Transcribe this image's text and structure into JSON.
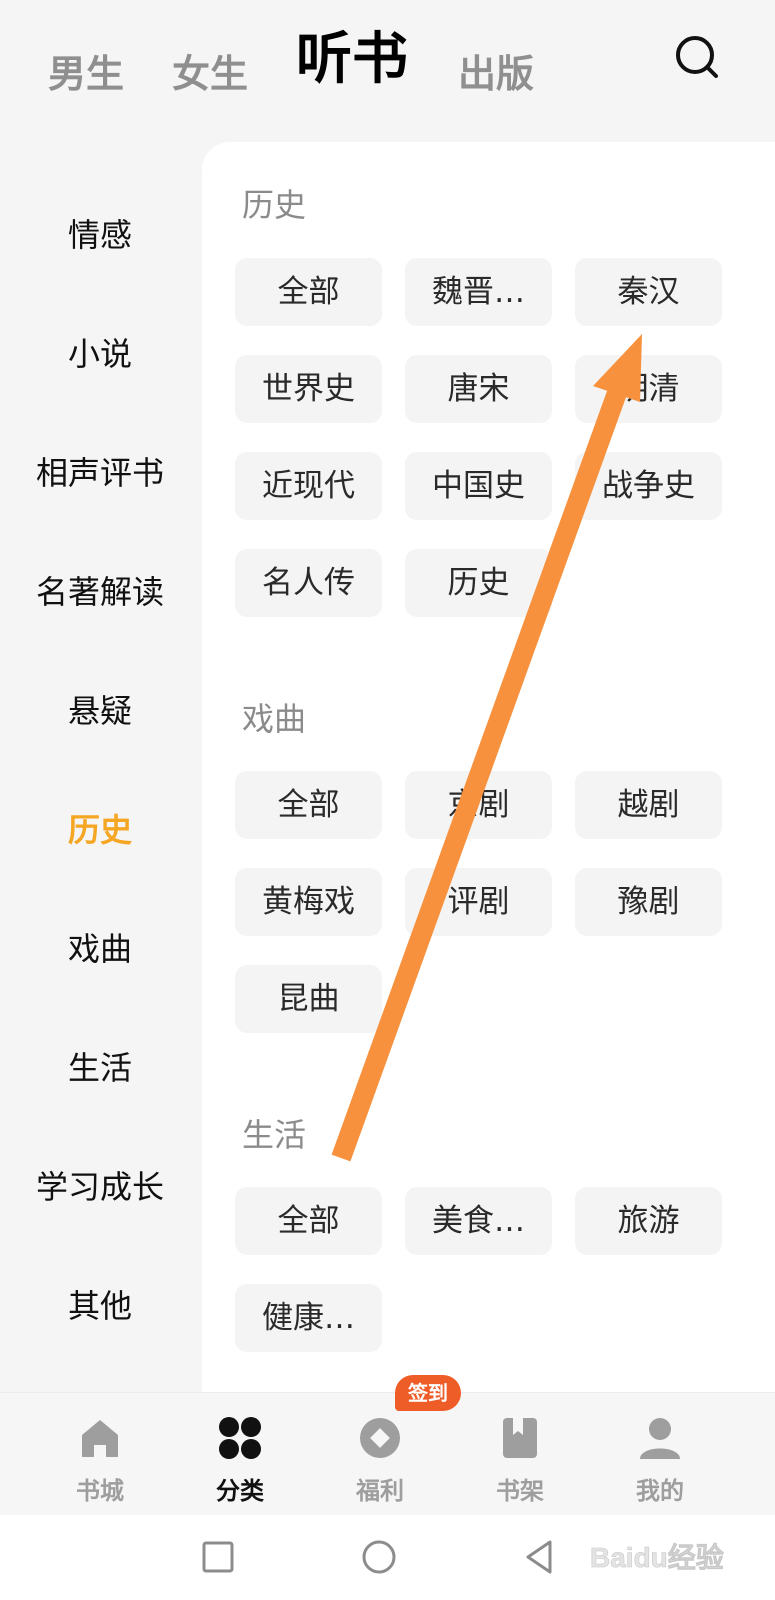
{
  "top_tabs": [
    "男生",
    "女生",
    "听书",
    "出版"
  ],
  "sidebar": {
    "items": [
      "情感",
      "小说",
      "相声评书",
      "名著解读",
      "悬疑",
      "历史",
      "戏曲",
      "生活",
      "学习成长",
      "其他"
    ],
    "active": "历史"
  },
  "sections": [
    {
      "title": "历史",
      "chips": [
        "全部",
        "魏晋…",
        "秦汉",
        "世界史",
        "唐宋",
        "明清",
        "近现代",
        "中国史",
        "战争史",
        "名人传",
        "历史"
      ]
    },
    {
      "title": "戏曲",
      "chips": [
        "全部",
        "京剧",
        "越剧",
        "黄梅戏",
        "评剧",
        "豫剧",
        "昆曲"
      ]
    },
    {
      "title": "生活",
      "chips": [
        "全部",
        "美食…",
        "旅游",
        "健康…"
      ]
    }
  ],
  "bottom_nav": [
    {
      "label": "书城",
      "icon": "home-icon"
    },
    {
      "label": "分类",
      "icon": "category-icon",
      "active": true
    },
    {
      "label": "福利",
      "icon": "coin-icon"
    },
    {
      "label": "书架",
      "icon": "bookshelf-icon"
    },
    {
      "label": "我的",
      "icon": "profile-icon"
    }
  ],
  "bottom_badge": "签到",
  "watermark": "Baidu经验",
  "colors": {
    "accent": "#f5a623",
    "badge": "#ee5d28",
    "arrow": "#f7913d"
  }
}
